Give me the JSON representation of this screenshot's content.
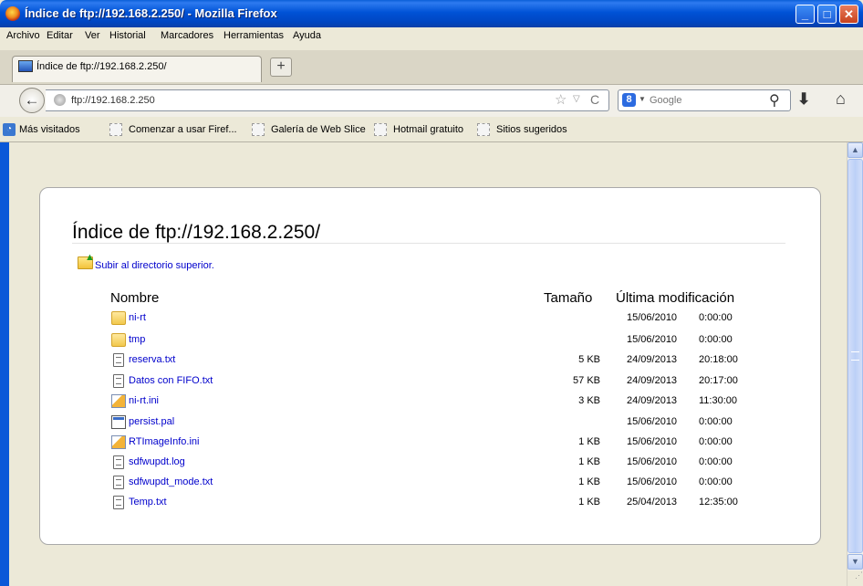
{
  "window": {
    "title": "Índice de ftp://192.168.2.250/ - Mozilla Firefox",
    "btn_min": "_",
    "btn_max": "□",
    "btn_close": "✕"
  },
  "menu": [
    "Archivo",
    "Editar",
    "Ver",
    "Historial",
    "Marcadores",
    "Herramientas",
    "Ayuda"
  ],
  "tab": {
    "label": "Índice de ftp://192.168.2.250/",
    "new_tab_label": "+"
  },
  "nav": {
    "back": "←",
    "url": "ftp://192.168.2.250",
    "star": "☆",
    "drop": "▽",
    "reload": "C",
    "search_engine": "8",
    "search_engine_drop": "▼",
    "search_placeholder": "Google",
    "search_glass": "⚲",
    "download": "⬇",
    "home": "⌂"
  },
  "bookmarks": [
    "Más visitados",
    "Comenzar a usar Firef...",
    "Galería de Web Slice",
    "Hotmail gratuito",
    "Sitios sugeridos"
  ],
  "page": {
    "title": "Índice de ftp://192.168.2.250/",
    "up_link": "Subir al directorio superior.",
    "headers": {
      "name": "Nombre",
      "size": "Tamaño",
      "modified": "Última modificación"
    },
    "files": [
      {
        "name": "ni-rt",
        "type": "folder",
        "size": "",
        "date": "15/06/2010",
        "time": "0:00:00"
      },
      {
        "name": "tmp",
        "type": "folder",
        "size": "",
        "date": "15/06/2010",
        "time": "0:00:00"
      },
      {
        "name": "reserva.txt",
        "type": "text",
        "size": "5 KB",
        "date": "24/09/2013",
        "time": "20:18:00"
      },
      {
        "name": "Datos con FIFO.txt",
        "type": "text",
        "size": "57 KB",
        "date": "24/09/2013",
        "time": "20:17:00"
      },
      {
        "name": "ni-rt.ini",
        "type": "ini",
        "size": "3 KB",
        "date": "24/09/2013",
        "time": "11:30:00"
      },
      {
        "name": "persist.pal",
        "type": "pal",
        "size": "",
        "date": "15/06/2010",
        "time": "0:00:00"
      },
      {
        "name": "RTImageInfo.ini",
        "type": "ini",
        "size": "1 KB",
        "date": "15/06/2010",
        "time": "0:00:00"
      },
      {
        "name": "sdfwupdt.log",
        "type": "text",
        "size": "1 KB",
        "date": "15/06/2010",
        "time": "0:00:00"
      },
      {
        "name": "sdfwupdt_mode.txt",
        "type": "text",
        "size": "1 KB",
        "date": "15/06/2010",
        "time": "0:00:00"
      },
      {
        "name": "Temp.txt",
        "type": "text",
        "size": "1 KB",
        "date": "25/04/2013",
        "time": "12:35:00"
      }
    ]
  },
  "scrollbar": {
    "up": "▲",
    "down": "▼",
    "grip": "⋰"
  }
}
